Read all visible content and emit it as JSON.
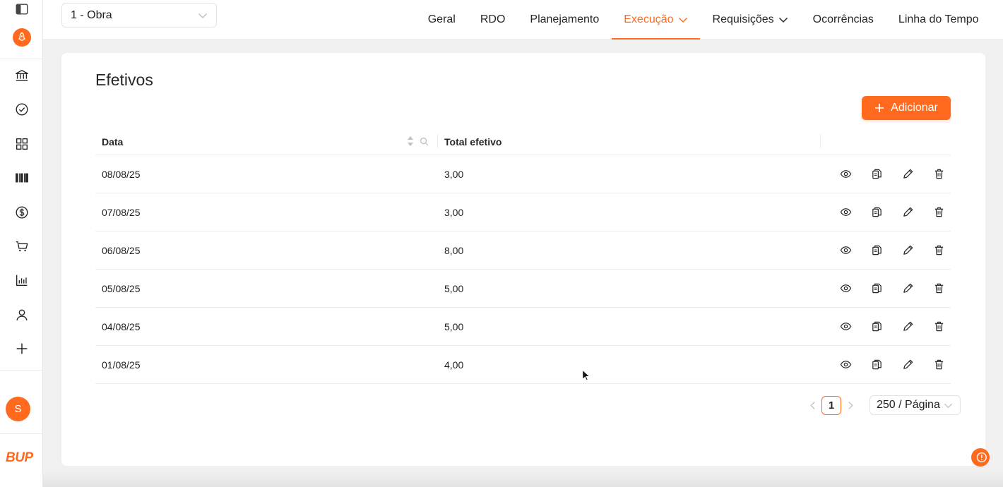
{
  "theme": {
    "accent": "#ff6a1f",
    "text": "#262626",
    "muted": "#bfbfbf",
    "brand": "#ff6a1f"
  },
  "sidebar": {
    "items": [
      {
        "icon": "bank-icon",
        "name": "sidebar-item-bank"
      },
      {
        "icon": "check-circle-icon",
        "name": "sidebar-item-tasks"
      },
      {
        "icon": "grid-icon",
        "name": "sidebar-item-apps"
      },
      {
        "icon": "barcode-icon",
        "name": "sidebar-item-stock"
      },
      {
        "icon": "dollar-circle-icon",
        "name": "sidebar-item-finance"
      },
      {
        "icon": "cart-icon",
        "name": "sidebar-item-purchases"
      },
      {
        "icon": "bar-chart-icon",
        "name": "sidebar-item-reports"
      },
      {
        "icon": "user-icon",
        "name": "sidebar-item-users"
      },
      {
        "icon": "plus-icon",
        "name": "sidebar-item-add"
      }
    ],
    "avatar_initial": "S",
    "brand_text": "BUP"
  },
  "header": {
    "project_select": "1 - Obra",
    "nav": [
      {
        "label": "Geral",
        "active": false,
        "dropdown": false
      },
      {
        "label": "RDO",
        "active": false,
        "dropdown": false
      },
      {
        "label": "Planejamento",
        "active": false,
        "dropdown": false
      },
      {
        "label": "Execução",
        "active": true,
        "dropdown": true
      },
      {
        "label": "Requisições",
        "active": false,
        "dropdown": true
      },
      {
        "label": "Ocorrências",
        "active": false,
        "dropdown": false
      },
      {
        "label": "Linha do Tempo",
        "active": false,
        "dropdown": false
      }
    ]
  },
  "page": {
    "title": "Efetivos",
    "add_button": "Adicionar"
  },
  "table": {
    "columns": [
      "Data",
      "Total efetivo"
    ],
    "rows": [
      {
        "date": "08/08/25",
        "total": "3,00"
      },
      {
        "date": "07/08/25",
        "total": "3,00"
      },
      {
        "date": "06/08/25",
        "total": "8,00"
      },
      {
        "date": "05/08/25",
        "total": "5,00"
      },
      {
        "date": "04/08/25",
        "total": "5,00"
      },
      {
        "date": "01/08/25",
        "total": "4,00"
      }
    ],
    "row_actions": [
      "eye-icon",
      "copy-icon",
      "edit-icon",
      "delete-icon"
    ]
  },
  "pagination": {
    "current_page": "1",
    "page_size": "250 / Página"
  }
}
